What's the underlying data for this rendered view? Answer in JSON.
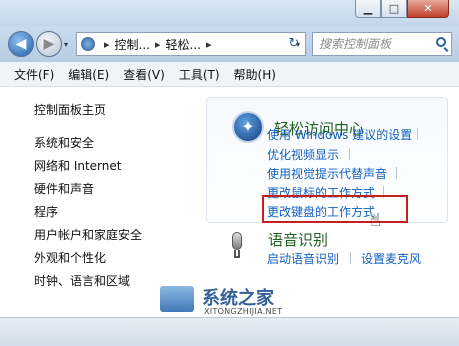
{
  "window": {
    "min": "▁",
    "max": "□",
    "close": "✕"
  },
  "nav": {
    "back": "◀",
    "forward": "▶",
    "dropdown": "▾",
    "address": [
      "控制...",
      "轻松..."
    ],
    "address_sep": "▸",
    "refresh": "↻",
    "search_placeholder": "搜索控制面板"
  },
  "menu": [
    "文件(F)",
    "编辑(E)",
    "查看(V)",
    "工具(T)",
    "帮助(H)"
  ],
  "sidebar": {
    "home": "控制面板主页",
    "items": [
      "系统和安全",
      "网络和 Internet",
      "硬件和声音",
      "程序",
      "用户帐户和家庭安全",
      "外观和个性化",
      "时钟、语言和区域"
    ]
  },
  "ease_of_access": {
    "title": "轻松访问中心",
    "links": [
      "使用 Windows 建议的设置",
      "优化视频显示",
      "使用视觉提示代替声音",
      "更改鼠标的工作方式",
      "更改键盘的工作方式"
    ]
  },
  "speech": {
    "title": "语音识别",
    "links": [
      "启动语音识别",
      "设置麦克风"
    ]
  },
  "watermark": {
    "text": "系统之家",
    "sub": "XITONGZHIJIA.NET"
  },
  "colors": {
    "link": "#1060c0",
    "section_title": "#1f5f1f",
    "highlight": "#c42020"
  }
}
